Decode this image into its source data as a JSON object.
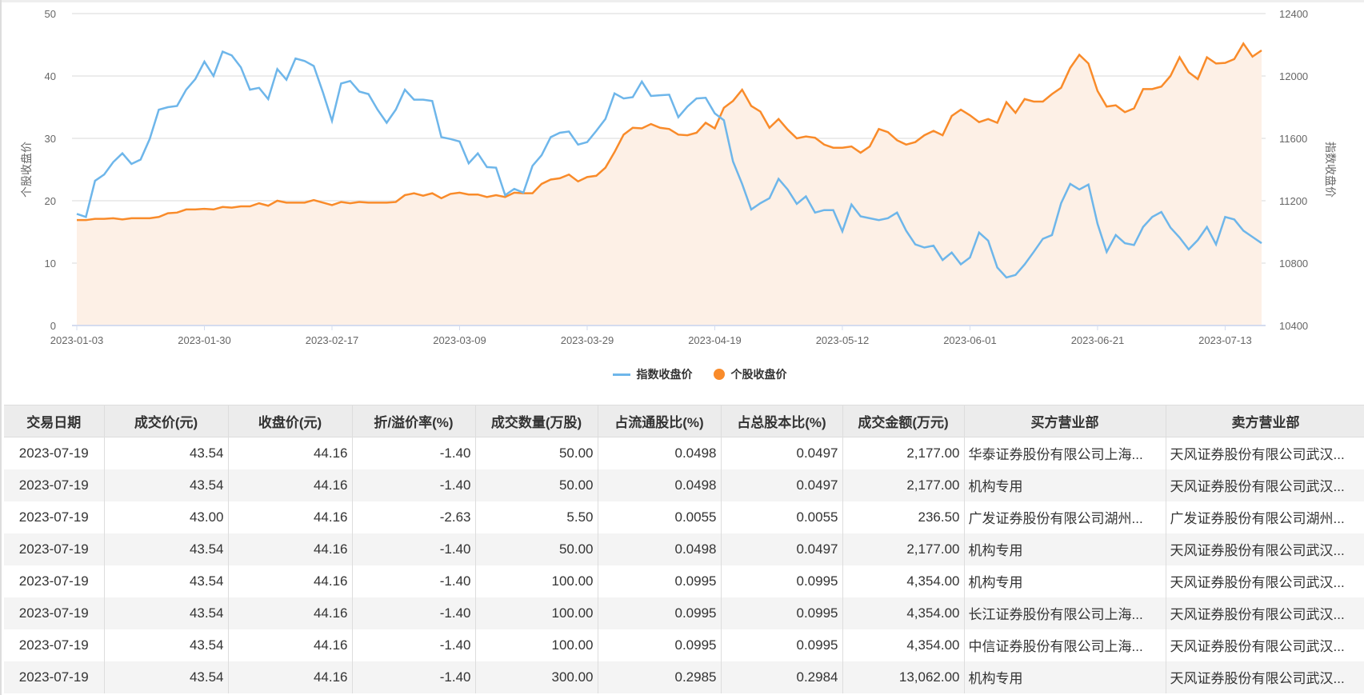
{
  "chart_data": {
    "type": "line",
    "series": [
      {
        "name": "指数收盘价",
        "axis": "right",
        "color": "#6eb6ea",
        "values": [
          11116,
          11096,
          11328,
          11368,
          11448,
          11504,
          11436,
          11464,
          11596,
          11784,
          11800,
          11808,
          11912,
          11980,
          12092,
          12000,
          12156,
          12132,
          12056,
          11912,
          11924,
          11852,
          12044,
          11976,
          12112,
          12096,
          12064,
          11896,
          11712,
          11952,
          11968,
          11900,
          11884,
          11784,
          11700,
          11784,
          11912,
          11848,
          11848,
          11840,
          11608,
          11596,
          11580,
          11440,
          11504,
          11416,
          11412,
          11236,
          11276,
          11252,
          11424,
          11492,
          11608,
          11636,
          11644,
          11560,
          11576,
          11648,
          11724,
          11888,
          11856,
          11864,
          11964,
          11872,
          11876,
          11880,
          11736,
          11804,
          11856,
          11860,
          11760,
          11716,
          11452,
          11308,
          11144,
          11184,
          11216,
          11340,
          11272,
          11180,
          11228,
          11124,
          11140,
          11140,
          11004,
          11176,
          11100,
          11088,
          11076,
          11088,
          11124,
          11008,
          10920,
          10900,
          10912,
          10820,
          10868,
          10792,
          10836,
          10996,
          10944,
          10772,
          10708,
          10724,
          10792,
          10872,
          10956,
          10980,
          11184,
          11308,
          11272,
          11304,
          11052,
          10872,
          10980,
          10928,
          10916,
          11032,
          11096,
          11128,
          11028,
          10964,
          10888,
          10948,
          11032,
          10920,
          11096,
          11080,
          11008,
          10968,
          10928
        ]
      },
      {
        "name": "个股收盘价",
        "axis": "left",
        "color": "#f98b2a",
        "fill": "#fdf0e6",
        "values": [
          16.9,
          16.9,
          17.1,
          17.1,
          17.2,
          17.0,
          17.2,
          17.2,
          17.2,
          17.4,
          18.0,
          18.1,
          18.6,
          18.6,
          18.7,
          18.6,
          19.0,
          18.9,
          19.1,
          19.1,
          19.6,
          19.2,
          20.0,
          19.7,
          19.7,
          19.7,
          20.1,
          19.7,
          19.3,
          19.8,
          19.6,
          19.8,
          19.7,
          19.7,
          19.7,
          19.8,
          20.9,
          21.2,
          20.8,
          21.2,
          20.4,
          21.1,
          21.3,
          21.0,
          21.0,
          20.6,
          20.9,
          20.6,
          21.3,
          21.2,
          21.2,
          22.7,
          23.4,
          23.6,
          24.2,
          23.1,
          23.8,
          24.0,
          25.3,
          27.8,
          30.6,
          31.7,
          31.6,
          32.3,
          31.7,
          31.5,
          30.6,
          30.5,
          30.9,
          32.5,
          31.6,
          34.9,
          36.0,
          37.8,
          35.2,
          34.3,
          31.7,
          33.1,
          31.4,
          30.0,
          30.3,
          30.1,
          29.0,
          28.5,
          28.5,
          28.7,
          27.7,
          28.7,
          31.5,
          31.0,
          29.7,
          29.0,
          29.4,
          30.5,
          31.2,
          30.5,
          33.6,
          34.6,
          33.7,
          32.6,
          33.1,
          32.5,
          35.8,
          34.1,
          36.3,
          35.9,
          35.9,
          37.1,
          38.1,
          41.3,
          43.4,
          42.0,
          37.6,
          35.1,
          35.3,
          34.2,
          34.8,
          37.9,
          37.9,
          38.3,
          40.0,
          43.0,
          40.6,
          39.5,
          43.0,
          42.0,
          42.1,
          42.7,
          45.2,
          43.1,
          44.1
        ]
      }
    ],
    "x_ticks": [
      {
        "index": 0,
        "label": "2023-01-03"
      },
      {
        "index": 14,
        "label": "2023-01-30"
      },
      {
        "index": 28,
        "label": "2023-02-17"
      },
      {
        "index": 42,
        "label": "2023-03-09"
      },
      {
        "index": 56,
        "label": "2023-03-29"
      },
      {
        "index": 70,
        "label": "2023-04-19"
      },
      {
        "index": 84,
        "label": "2023-05-12"
      },
      {
        "index": 98,
        "label": "2023-06-01"
      },
      {
        "index": 112,
        "label": "2023-06-21"
      },
      {
        "index": 126,
        "label": "2023-07-13"
      }
    ],
    "left_axis": {
      "label": "个股收盘价",
      "ylim": [
        0,
        50
      ],
      "ticks": [
        "0",
        "10",
        "20",
        "30",
        "40",
        "50"
      ]
    },
    "right_axis": {
      "label": "指数收盘价",
      "ylim": [
        10400,
        12400
      ],
      "ticks": [
        "10400",
        "10800",
        "11200",
        "11600",
        "12000",
        "12400"
      ]
    },
    "grid": true,
    "legend_position": "bottom-center"
  },
  "legend": {
    "index": "指数收盘价",
    "stock": "个股收盘价"
  },
  "table": {
    "headers": [
      "交易日期",
      "成交价(元)",
      "收盘价(元)",
      "折/溢价率(%)",
      "成交数量(万股)",
      "占流通股比(%)",
      "占总股本比(%)",
      "成交金额(万元)",
      "买方营业部",
      "卖方营业部"
    ],
    "rows": [
      [
        "2023-07-19",
        "43.54",
        "44.16",
        "-1.40",
        "50.00",
        "0.0498",
        "0.0497",
        "2,177.00",
        "华泰证券股份有限公司上海...",
        "天风证券股份有限公司武汉..."
      ],
      [
        "2023-07-19",
        "43.54",
        "44.16",
        "-1.40",
        "50.00",
        "0.0498",
        "0.0497",
        "2,177.00",
        "机构专用",
        "天风证券股份有限公司武汉..."
      ],
      [
        "2023-07-19",
        "43.00",
        "44.16",
        "-2.63",
        "5.50",
        "0.0055",
        "0.0055",
        "236.50",
        "广发证券股份有限公司湖州...",
        "广发证券股份有限公司湖州..."
      ],
      [
        "2023-07-19",
        "43.54",
        "44.16",
        "-1.40",
        "50.00",
        "0.0498",
        "0.0497",
        "2,177.00",
        "机构专用",
        "天风证券股份有限公司武汉..."
      ],
      [
        "2023-07-19",
        "43.54",
        "44.16",
        "-1.40",
        "100.00",
        "0.0995",
        "0.0995",
        "4,354.00",
        "机构专用",
        "天风证券股份有限公司武汉..."
      ],
      [
        "2023-07-19",
        "43.54",
        "44.16",
        "-1.40",
        "100.00",
        "0.0995",
        "0.0995",
        "4,354.00",
        "长江证券股份有限公司上海...",
        "天风证券股份有限公司武汉..."
      ],
      [
        "2023-07-19",
        "43.54",
        "44.16",
        "-1.40",
        "100.00",
        "0.0995",
        "0.0995",
        "4,354.00",
        "中信证券股份有限公司上海...",
        "天风证券股份有限公司武汉..."
      ],
      [
        "2023-07-19",
        "43.54",
        "44.16",
        "-1.40",
        "300.00",
        "0.2985",
        "0.2984",
        "13,062.00",
        "机构专用",
        "天风证券股份有限公司武汉..."
      ]
    ]
  }
}
